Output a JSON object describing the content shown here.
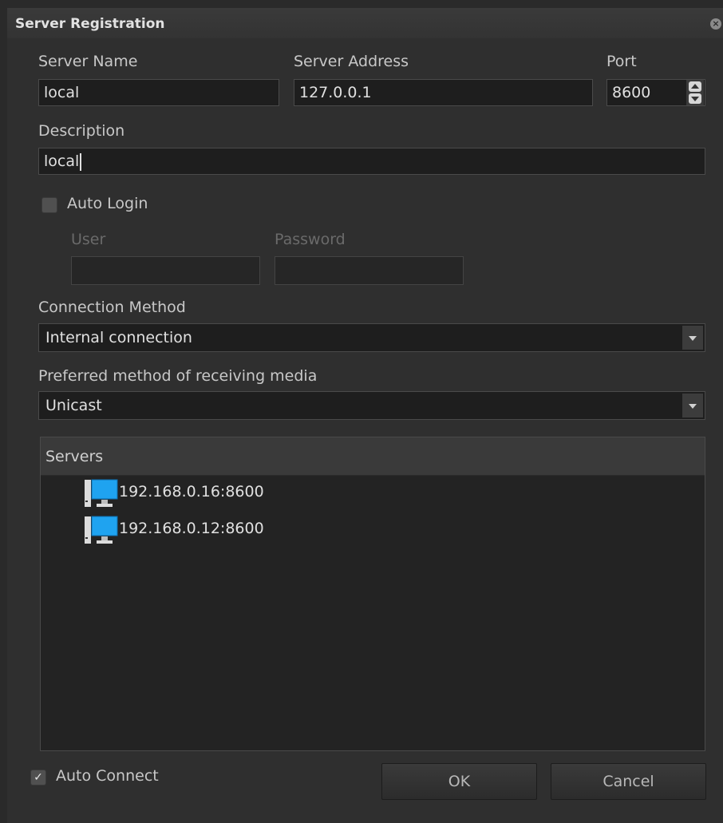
{
  "window": {
    "title": "Server Registration",
    "close_icon": "close-icon"
  },
  "form": {
    "server_name": {
      "label": "Server Name",
      "value": "local"
    },
    "server_address": {
      "label": "Server Address",
      "value": "127.0.0.1"
    },
    "port": {
      "label": "Port",
      "value": "8600"
    },
    "description": {
      "label": "Description",
      "value": "local"
    },
    "auto_login": {
      "label": "Auto Login",
      "checked": false
    },
    "user": {
      "label": "User",
      "value": ""
    },
    "password": {
      "label": "Password",
      "value": ""
    },
    "connection_method": {
      "label": "Connection Method",
      "value": "Internal connection"
    },
    "receiving_media": {
      "label": "Preferred method of receiving media",
      "value": "Unicast"
    }
  },
  "servers": {
    "header": "Servers",
    "items": [
      {
        "label": "192.168.0.16:8600",
        "icon": "computer-icon"
      },
      {
        "label": "192.168.0.12:8600",
        "icon": "computer-icon"
      }
    ]
  },
  "footer": {
    "auto_connect": {
      "label": "Auto Connect",
      "checked": true,
      "mark": "✓"
    },
    "ok_label": "OK",
    "cancel_label": "Cancel"
  },
  "colors": {
    "background": "#2f2f2f",
    "field": "#1e1e1e",
    "monitor": "#1fa3f0"
  }
}
